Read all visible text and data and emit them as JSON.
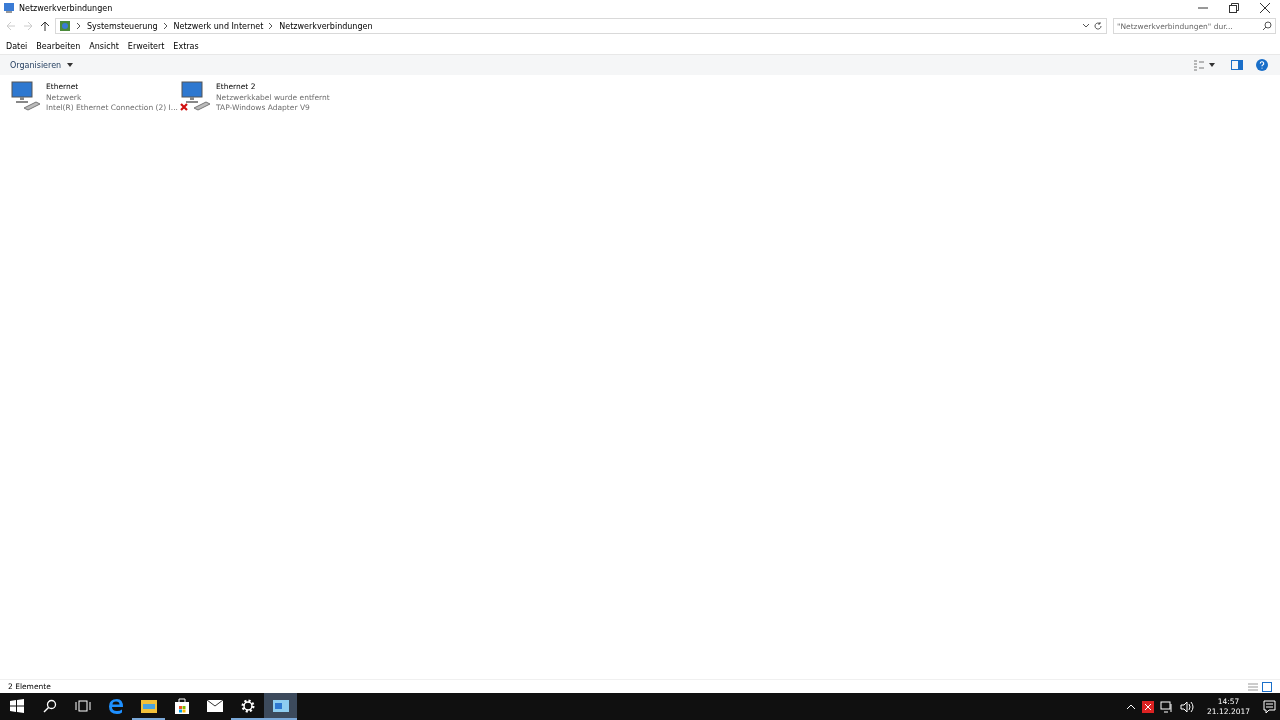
{
  "window": {
    "title": "Netzwerkverbindungen"
  },
  "address": {
    "crumbs": [
      "Systemsteuerung",
      "Netzwerk und Internet",
      "Netzwerkverbindungen"
    ],
    "search_placeholder": "\"Netzwerkverbindungen\" dur..."
  },
  "menu": [
    "Datei",
    "Bearbeiten",
    "Ansicht",
    "Erweitert",
    "Extras"
  ],
  "command_bar": {
    "organize": "Organisieren"
  },
  "connections": [
    {
      "name": "Ethernet",
      "status": "Netzwerk",
      "adapter": "Intel(R) Ethernet Connection (2) I...",
      "disconnected": false
    },
    {
      "name": "Ethernet 2",
      "status": "Netzwerkkabel wurde entfernt",
      "adapter": "TAP-Windows Adapter V9",
      "disconnected": true
    }
  ],
  "status_bar": {
    "count": "2 Elemente"
  },
  "taskbar": {
    "apps": [
      {
        "kind": "edge",
        "running": false,
        "selected": false
      },
      {
        "kind": "explorer",
        "running": true,
        "selected": false
      },
      {
        "kind": "store",
        "running": false,
        "selected": false
      },
      {
        "kind": "mail",
        "running": false,
        "selected": false
      },
      {
        "kind": "settings",
        "running": true,
        "selected": false
      },
      {
        "kind": "network",
        "running": true,
        "selected": true
      }
    ],
    "time": "14:57",
    "date": "21.12.2017"
  }
}
